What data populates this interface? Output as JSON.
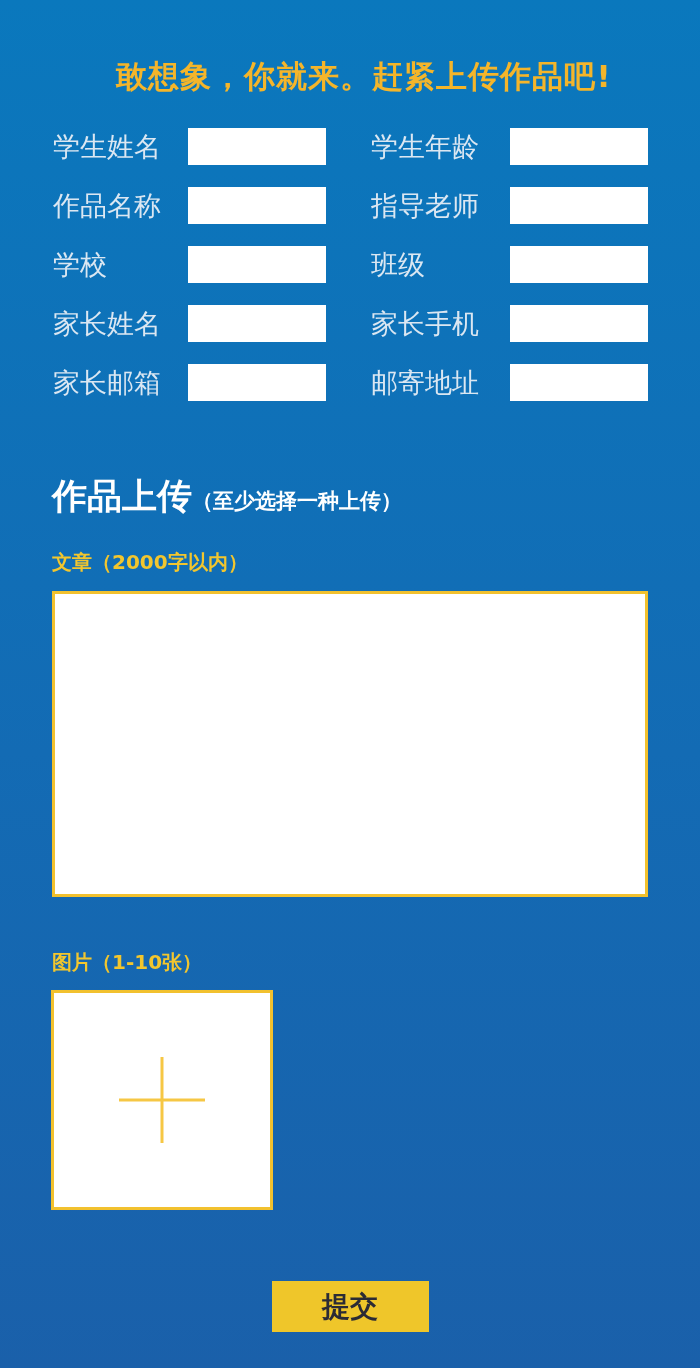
{
  "title": "敢想象，你就来。赶紧上传作品吧!",
  "form_fields": [
    {
      "label": "学生姓名"
    },
    {
      "label": "学生年龄"
    },
    {
      "label": "作品名称"
    },
    {
      "label": "指导老师"
    },
    {
      "label": "学校"
    },
    {
      "label": "班级"
    },
    {
      "label": "家长姓名"
    },
    {
      "label": "家长手机"
    },
    {
      "label": "家长邮箱"
    },
    {
      "label": "邮寄地址"
    }
  ],
  "upload_section": {
    "heading": "作品上传",
    "note": "（至少选择一种上传）",
    "article": {
      "label": "文章（2000字以内）"
    },
    "images": {
      "label": "图片（1-10张）"
    }
  },
  "submit_button": {
    "label": "提交"
  }
}
